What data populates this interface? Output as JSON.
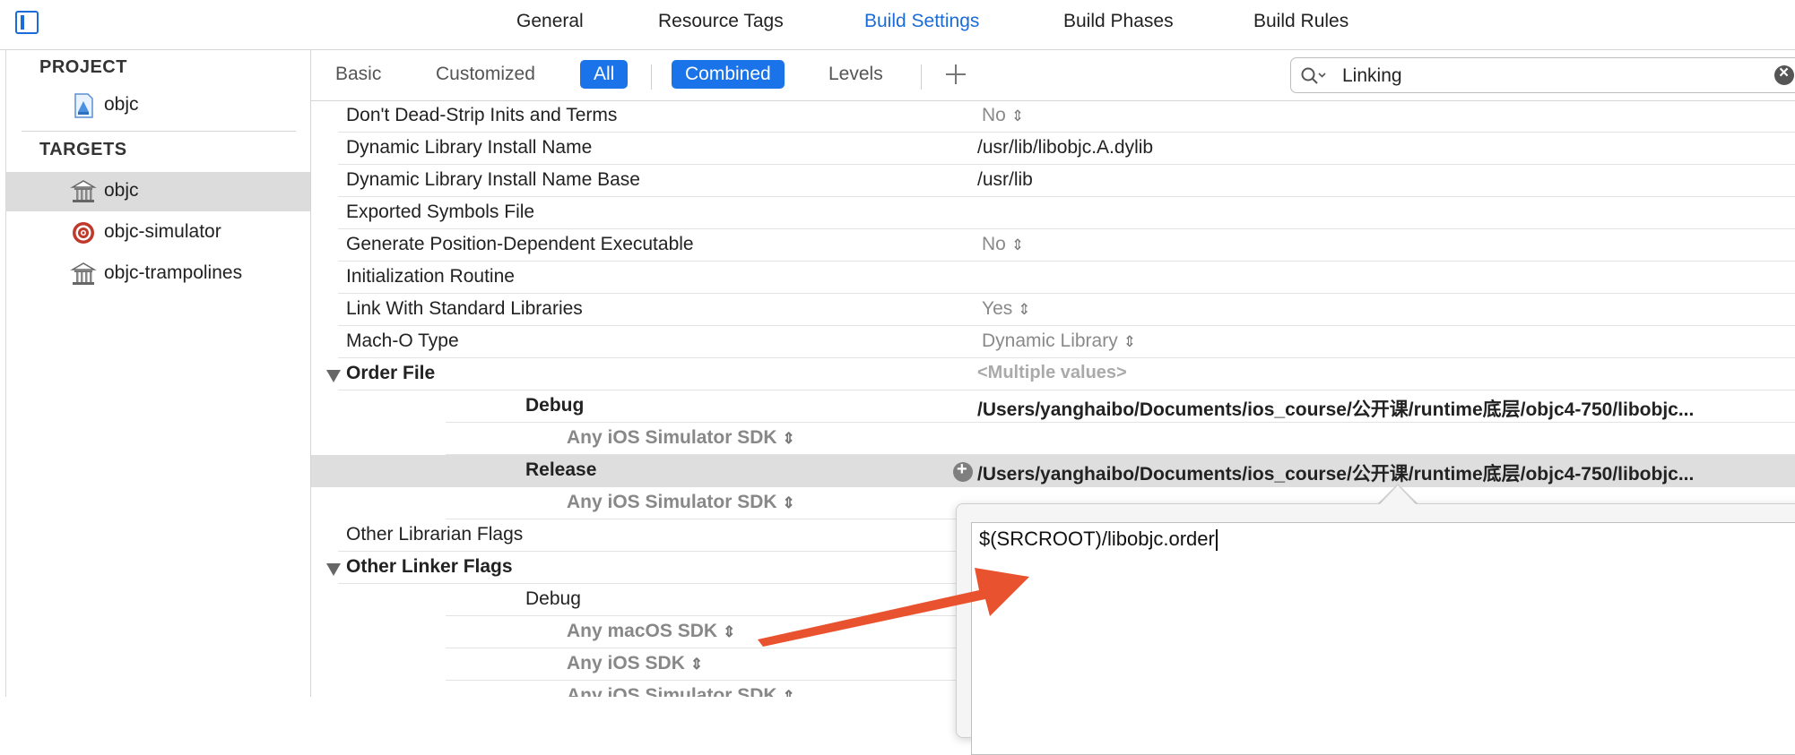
{
  "tabs": [
    "General",
    "Resource Tags",
    "Build Settings",
    "Build Phases",
    "Build Rules"
  ],
  "sidebar": {
    "project_header": "PROJECT",
    "project_item": "objc",
    "targets_header": "TARGETS",
    "targets": [
      "objc",
      "objc-simulator",
      "objc-trampolines"
    ]
  },
  "filters": {
    "basic": "Basic",
    "customized": "Customized",
    "all": "All",
    "combined": "Combined",
    "levels": "Levels"
  },
  "search": {
    "value": "Linking"
  },
  "settings": [
    {
      "name": "Don't Dead-Strip Inits and Terms",
      "value": "No"
    },
    {
      "name": "Dynamic Library Install Name",
      "value": "/usr/lib/libobjc.A.dylib"
    },
    {
      "name": "Dynamic Library Install Name Base",
      "value": "/usr/lib"
    },
    {
      "name": "Exported Symbols File",
      "value": ""
    },
    {
      "name": "Generate Position-Dependent Executable",
      "value": "No"
    },
    {
      "name": "Initialization Routine",
      "value": ""
    },
    {
      "name": "Link With Standard Libraries",
      "value": "Yes"
    },
    {
      "name": "Mach-O Type",
      "value": "Dynamic Library"
    },
    {
      "name": "Order File",
      "value": "<Multiple values>"
    },
    {
      "name": "Debug",
      "value": "/Users/yanghaibo/Documents/ios_course/公开课/runtime底层/objc4-750/libobjc..."
    },
    {
      "name": "Any iOS Simulator SDK",
      "value": ""
    },
    {
      "name": "Release",
      "value": "/Users/yanghaibo/Documents/ios_course/公开课/runtime底层/objc4-750/libobjc..."
    },
    {
      "name": "Any iOS Simulator SDK",
      "value": ""
    },
    {
      "name": "Other Librarian Flags",
      "value": ""
    },
    {
      "name": "Other Linker Flags",
      "value": ""
    },
    {
      "name": "Debug",
      "value": ""
    },
    {
      "name": "Any macOS SDK",
      "value": ""
    },
    {
      "name": "Any iOS SDK",
      "value": ""
    },
    {
      "name": "Any iOS Simulator SDK",
      "value": ""
    }
  ],
  "popover": {
    "value": "$(SRCROOT)/libobjc.order"
  },
  "colors": {
    "accent": "#1a73e8",
    "annotation_arrow": "#e8522f",
    "selected_row": "#dedede"
  },
  "icons": [
    "sidebar-toggle-icon",
    "project-file-icon",
    "target-framework-icon",
    "target-app-icon",
    "search-icon",
    "clear-search-icon",
    "add-icon",
    "disclosure-triangle-icon",
    "stepper-icon"
  ]
}
